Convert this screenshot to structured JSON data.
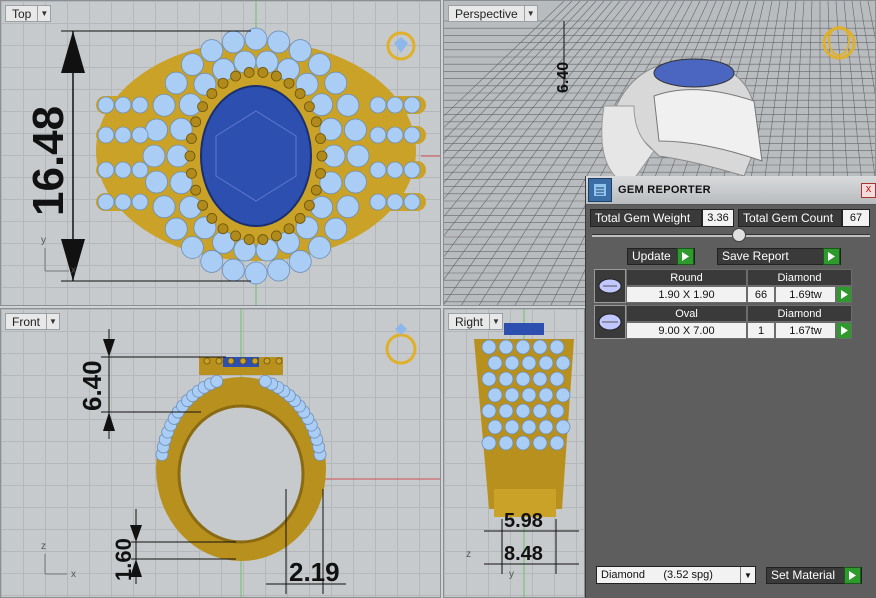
{
  "viewports": {
    "top": {
      "label": "Top",
      "dimension": "16.48",
      "axis_y": "y",
      "axis_x": "x"
    },
    "perspective": {
      "label": "Perspective",
      "dimension": "6.40"
    },
    "front": {
      "label": "Front",
      "dim_a": "6.40",
      "dim_b": "1.60",
      "dim_c": "2.19",
      "axis_y": "z",
      "axis_x": "x"
    },
    "right": {
      "label": "Right",
      "dim_a": "5.98",
      "dim_b": "8.48",
      "axis_y": "z",
      "axis_x": "y"
    }
  },
  "gem_reporter": {
    "title": "GEM REPORTER",
    "close": "x",
    "total_weight_label": "Total Gem Weight",
    "total_weight_value": "3.36",
    "total_count_label": "Total Gem Count",
    "total_count_value": "67",
    "update_label": "Update",
    "save_label": "Save Report",
    "gems": [
      {
        "shape": "Round",
        "material": "Diamond",
        "size": "1.90 X 1.90",
        "count": "66",
        "weight": "1.69tw"
      },
      {
        "shape": "Oval",
        "material": "Diamond",
        "size": "9.00 X 7.00",
        "count": "1",
        "weight": "1.67tw"
      }
    ],
    "material_select": "Diamond      (3.52 spg)",
    "set_material_label": "Set Material"
  },
  "colors": {
    "gold": "#c9a227",
    "diamond": "#a9cdf5",
    "sapphire": "#2d4fb0",
    "panel": "#5e5e5e"
  }
}
